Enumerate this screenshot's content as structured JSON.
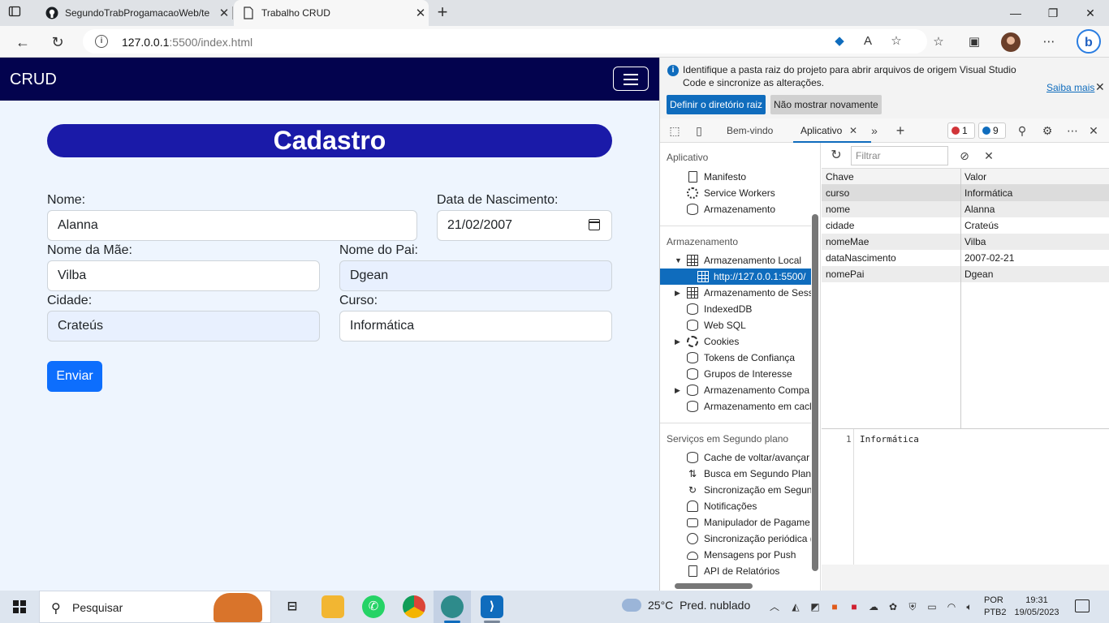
{
  "browser": {
    "tabs": [
      {
        "title": "SegundoTrabProgamacaoWeb/te",
        "icon": "github-icon"
      },
      {
        "title": "Trabalho CRUD",
        "icon": "page-icon"
      }
    ],
    "url_host": "127.0.0.1",
    "url_path": ":5500/index.html"
  },
  "page": {
    "brand": "CRUD",
    "heading": "Cadastro",
    "fields": {
      "nome": {
        "label": "Nome:",
        "value": "Alanna"
      },
      "nascimento": {
        "label": "Data de Nascimento:",
        "value": "21/02/2007"
      },
      "mae": {
        "label": "Nome da Mãe:",
        "value": "Vilba"
      },
      "pai": {
        "label": "Nome do Pai:",
        "value": "Dgean"
      },
      "cidade": {
        "label": "Cidade:",
        "value": "Crateús"
      },
      "curso": {
        "label": "Curso:",
        "value": "Informática"
      }
    },
    "submit": "Enviar"
  },
  "devtools": {
    "info_message": "Identifique a pasta raiz do projeto para abrir arquivos de origem Visual Studio Code e sincronize as alterações.",
    "learn_more": "Saiba mais",
    "set_root_btn": "Definir o diretório raiz",
    "dont_show_btn": "Não mostrar novamente",
    "tabs": {
      "welcome": "Bem-vindo",
      "application": "Aplicativo"
    },
    "error_count": "1",
    "message_count": "9",
    "filter_placeholder": "Filtrar",
    "sidebar": {
      "section_app": "Aplicativo",
      "app_items": [
        "Manifesto",
        "Service Workers",
        "Armazenamento"
      ],
      "section_storage": "Armazenamento",
      "storage_items": [
        "Armazenamento Local",
        "http://127.0.0.1:5500/",
        "Armazenamento de Sess",
        "IndexedDB",
        "Web SQL",
        "Cookies",
        "Tokens de Confiança",
        "Grupos de Interesse",
        "Armazenamento Compa",
        "Armazenamento em cacl"
      ],
      "section_bg": "Serviços em Segundo plano",
      "bg_items": [
        "Cache de voltar/avançar",
        "Busca em Segundo Planc",
        "Sincronização em Segun",
        "Notificações",
        "Manipulador de Pagame",
        "Sincronização periódica (",
        "Mensagens por Push",
        "API de Relatórios"
      ]
    },
    "table": {
      "col_key": "Chave",
      "col_value": "Valor",
      "rows": [
        {
          "key": "curso",
          "value": "Informática"
        },
        {
          "key": "nome",
          "value": "Alanna"
        },
        {
          "key": "cidade",
          "value": "Crateús"
        },
        {
          "key": "nomeMae",
          "value": "Vilba"
        },
        {
          "key": "dataNascimento",
          "value": "2007-02-21"
        },
        {
          "key": "nomePai",
          "value": "Dgean"
        }
      ]
    },
    "preview_line": "1",
    "preview_value": "Informática"
  },
  "taskbar": {
    "search": "Pesquisar",
    "temperature": "25°C",
    "weather": "Pred. nublado",
    "lang_top": "POR",
    "lang_bottom": "PTB2",
    "time": "19:31",
    "date": "19/05/2023"
  },
  "colors": {
    "navbar": "#03034e",
    "heading_pill": "#1a1aa8",
    "submit": "#0d6efd",
    "page_bg": "#eef5fe",
    "devtools_accent": "#0f6cbd"
  }
}
